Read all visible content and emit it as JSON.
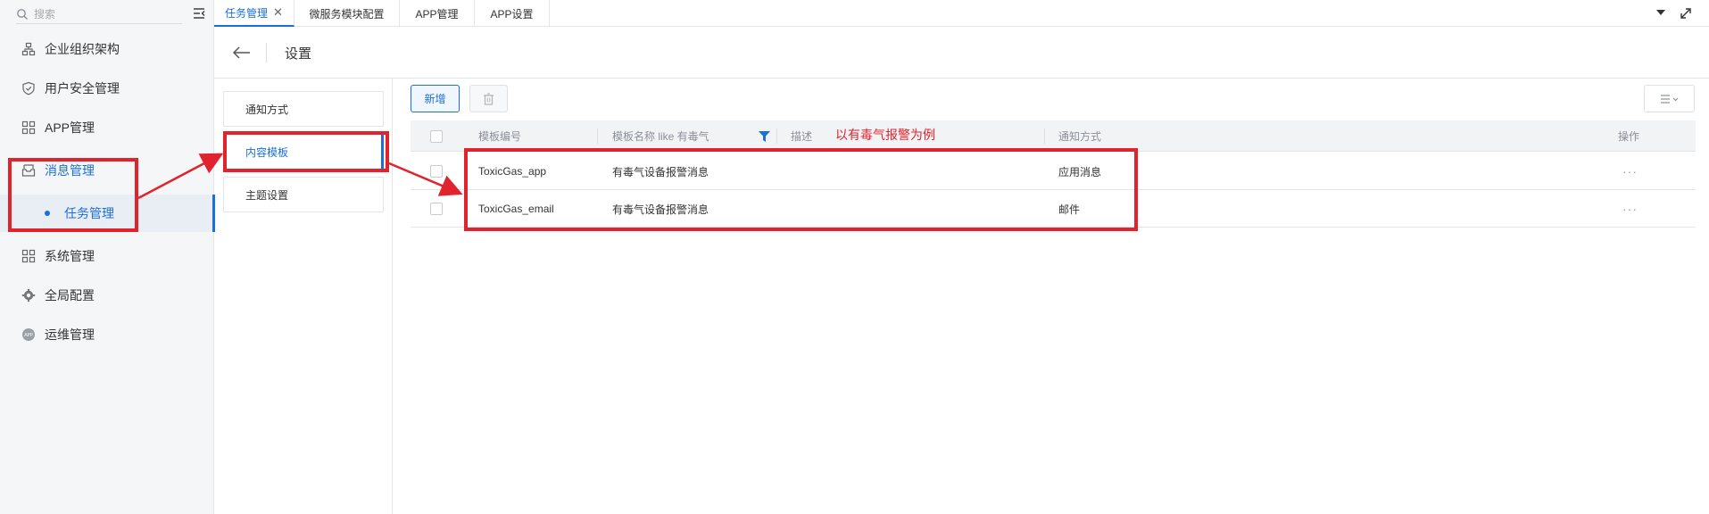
{
  "sidebar": {
    "search_placeholder": "搜索",
    "items": [
      {
        "label": "企业组织架构",
        "icon": "org-chart-icon"
      },
      {
        "label": "用户安全管理",
        "icon": "shield-check-icon"
      },
      {
        "label": "APP管理",
        "icon": "grid-icon"
      },
      {
        "label": "消息管理",
        "icon": "inbox-icon"
      },
      {
        "label": "系统管理",
        "icon": "grid-icon"
      },
      {
        "label": "全局配置",
        "icon": "gear-icon"
      },
      {
        "label": "运维管理",
        "icon": "app-badge-icon"
      }
    ],
    "sub_item": {
      "label": "任务管理"
    }
  },
  "tabs": [
    {
      "label": "任务管理",
      "active": true
    },
    {
      "label": "微服务模块配置"
    },
    {
      "label": "APP管理"
    },
    {
      "label": "APP设置"
    }
  ],
  "header": {
    "title": "设置"
  },
  "settings_menu": [
    {
      "label": "通知方式"
    },
    {
      "label": "内容模板",
      "active": true
    },
    {
      "label": "主题设置"
    }
  ],
  "toolbar": {
    "add_label": "新增"
  },
  "table": {
    "columns": [
      "模板编号",
      "模板名称 like 有毒气",
      "描述",
      "通知方式",
      "操作"
    ],
    "rows": [
      {
        "code": "ToxicGas_app",
        "name": "有毒气设备报警消息",
        "desc": "",
        "method": "应用消息",
        "action": "···"
      },
      {
        "code": "ToxicGas_email",
        "name": "有毒气设备报警消息",
        "desc": "",
        "method": "邮件",
        "action": "···"
      }
    ]
  },
  "annotation": {
    "text": "以有毒气报警为例"
  },
  "colors": {
    "accent": "#1a6fd9",
    "annotation": "#e0232d"
  }
}
